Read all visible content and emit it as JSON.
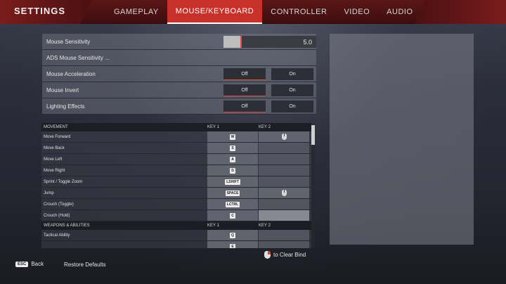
{
  "header": {
    "title": "SETTINGS",
    "tabs": [
      {
        "label": "GAMEPLAY",
        "active": false
      },
      {
        "label": "MOUSE/KEYBOARD",
        "active": true
      },
      {
        "label": "CONTROLLER",
        "active": false
      },
      {
        "label": "VIDEO",
        "active": false
      },
      {
        "label": "AUDIO",
        "active": false
      }
    ]
  },
  "settings": {
    "mouse_sensitivity": {
      "label": "Mouse Sensitivity",
      "value": "5.0",
      "fraction": 0.18
    },
    "ads_sensitivity": {
      "label": "ADS Mouse Sensitivity ..."
    },
    "mouse_acceleration": {
      "label": "Mouse Acceleration",
      "off": "Off",
      "on": "On"
    },
    "mouse_invert": {
      "label": "Mouse Invert",
      "off": "Off",
      "on": "On"
    },
    "lighting_effects": {
      "label": "Lighting Effects",
      "off": "Off",
      "on": "On"
    }
  },
  "keybinds": {
    "movement": {
      "header": "MOVEMENT",
      "key1": "KEY 1",
      "key2": "KEY 2",
      "rows": [
        {
          "name": "Move Forward",
          "key1": "W",
          "key2": "mouse"
        },
        {
          "name": "Move Back",
          "key1": "S",
          "key2": ""
        },
        {
          "name": "Move Left",
          "key1": "A",
          "key2": ""
        },
        {
          "name": "Move Right",
          "key1": "D",
          "key2": ""
        },
        {
          "name": "Sprint / Toggle Zoom",
          "key1": "LSHIFT",
          "key2": ""
        },
        {
          "name": "Jump",
          "key1": "SPACE",
          "key2": "mouse"
        },
        {
          "name": "Crouch (Toggle)",
          "key1": "LCTRL",
          "key2": ""
        },
        {
          "name": "Crouch (Hold)",
          "key1": "C",
          "key2": "light"
        }
      ]
    },
    "weapons": {
      "header": "WEAPONS & ABILITIES",
      "key1": "KEY 1",
      "key2": "KEY 2",
      "rows": [
        {
          "name": "Tactical Ability",
          "key1": "Q",
          "key2": ""
        },
        {
          "name": "",
          "key1": "E",
          "key2": ""
        }
      ]
    }
  },
  "footer": {
    "esc_key": "ESC",
    "back_label": "Back",
    "restore_label": "Restore Defaults",
    "clear_bind_label": "to Clear Bind"
  },
  "colors": {
    "accent": "#c8312a",
    "header_bg": "#4a1012"
  }
}
